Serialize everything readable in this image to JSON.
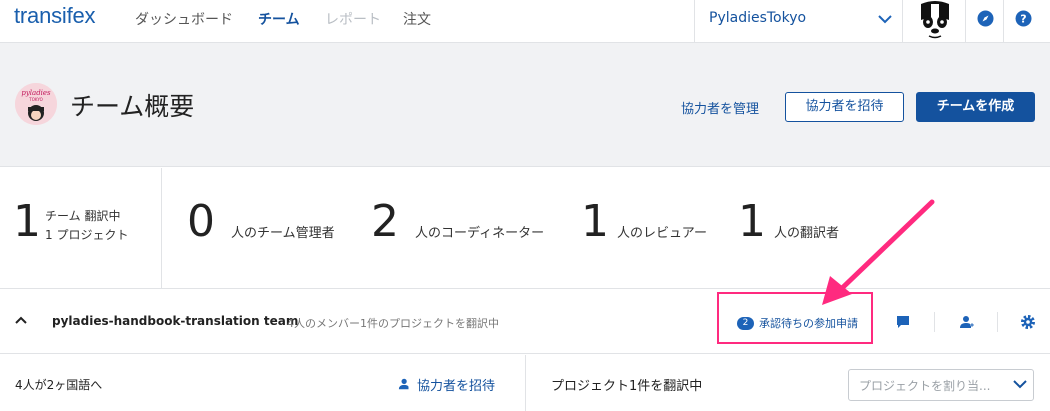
{
  "nav": {
    "logo": "transifex",
    "items": [
      {
        "label": "ダッシュボード",
        "state": "normal"
      },
      {
        "label": "チーム",
        "state": "active"
      },
      {
        "label": "レポート",
        "state": "disabled"
      },
      {
        "label": "注文",
        "state": "normal"
      }
    ],
    "org": "PyladiesTokyo",
    "icons": [
      "compass-icon",
      "help-icon"
    ]
  },
  "header": {
    "title": "チーム概要",
    "manage_link": "協力者を管理",
    "invite_button": "協力者を招待",
    "create_button": "チームを作成",
    "avatar_text": "pyladies TOKYO"
  },
  "stats": {
    "projects": {
      "value": "1",
      "label_line1": "チーム 翻訳中",
      "label_line2": "1 プロジェクト"
    },
    "items": [
      {
        "value": "0",
        "label": "人のチーム管理者"
      },
      {
        "value": "2",
        "label": "人のコーディネーター"
      },
      {
        "value": "1",
        "label": "人のレビュアー"
      },
      {
        "value": "1",
        "label": "人の翻訳者"
      }
    ]
  },
  "team": {
    "name": "pyladies-handbook-translation team",
    "meta": "4人のメンバー1件のプロジェクトを翻訳中",
    "pending_count": "2",
    "pending_label": "承認待ちの参加申請"
  },
  "bottom": {
    "languages": "4人が2ヶ国語へ",
    "invite_link": "協力者を招待",
    "projects": "プロジェクト1件を翻訳中",
    "project_select_placeholder": "プロジェクトを割り当..."
  },
  "colors": {
    "brand": "#14529e",
    "highlight": "#ff2a7f",
    "header_bg": "#f1f2f4"
  }
}
